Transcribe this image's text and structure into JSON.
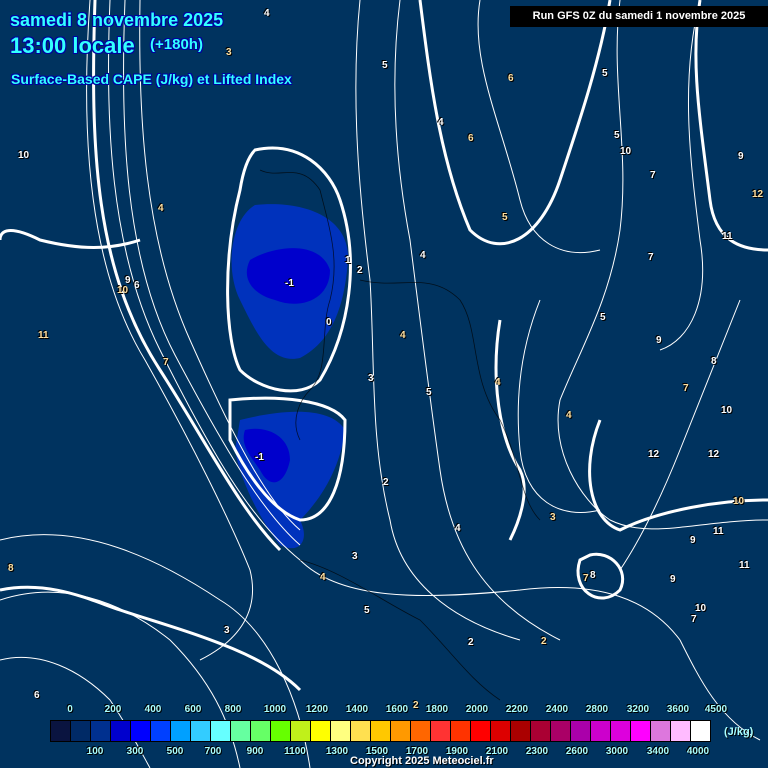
{
  "header": {
    "date": "samedi 8 novembre 2025",
    "time": "13:00 locale",
    "lead": "(+180h)",
    "parameter": "Surface-Based CAPE (J/kg) et Lifted Index",
    "run": "Run GFS 0Z du samedi 1 novembre 2025"
  },
  "colorbar": {
    "unit": "(J/kg)",
    "top_labels": [
      "0",
      "200",
      "400",
      "600",
      "800",
      "1000",
      "1200",
      "1400",
      "1600",
      "1800",
      "2000",
      "2200",
      "2400",
      "2800",
      "3200",
      "3600",
      "4500"
    ],
    "bottom_labels": [
      "100",
      "300",
      "500",
      "700",
      "900",
      "1100",
      "1300",
      "1500",
      "1700",
      "1900",
      "2100",
      "2300",
      "2600",
      "3000",
      "3400",
      "4000"
    ],
    "colors": [
      "#0a1440",
      "#002a66",
      "#00308f",
      "#0000cd",
      "#0000ff",
      "#0040ff",
      "#00a0ff",
      "#33ccff",
      "#66ffff",
      "#66ffa0",
      "#66ff66",
      "#66ff00",
      "#c0f01a",
      "#ffff00",
      "#ffff80",
      "#ffe050",
      "#ffc800",
      "#ff9900",
      "#ff6600",
      "#ff3333",
      "#ff3300",
      "#ff0000",
      "#dd0000",
      "#aa0000",
      "#aa0033",
      "#aa0066",
      "#aa00aa",
      "#cc00cc",
      "#dd00dd",
      "#ff00ff",
      "#dd77dd",
      "#ffbbff",
      "#ffffff"
    ]
  },
  "contour_labels": [
    "4",
    "3",
    "5",
    "10",
    "6",
    "5",
    "4",
    "6",
    "5",
    "10",
    "4",
    "7",
    "9",
    "12",
    "1",
    "4",
    "5",
    "11",
    "9",
    "10",
    "6",
    "7",
    "11",
    "-1",
    "2",
    "4",
    "0",
    "5",
    "7",
    "3",
    "5",
    "4",
    "8",
    "9",
    "7",
    "10",
    "-1",
    "4",
    "12",
    "2",
    "3",
    "12",
    "11",
    "10",
    "11",
    "8",
    "4",
    "3",
    "4",
    "2",
    "9",
    "5",
    "8",
    "7",
    "6",
    "2",
    "3",
    "2",
    "7",
    "10",
    "9"
  ],
  "copyright": "Copyright 2025 Meteociel.fr"
}
